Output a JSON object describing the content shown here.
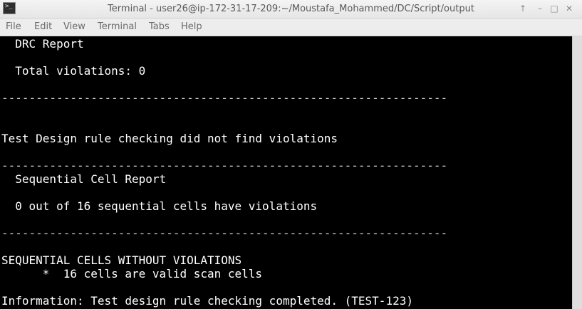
{
  "window": {
    "title": "Terminal - user26@ip-172-31-17-209:~/Moustafa_Mohammed/DC/Script/output",
    "app_icon": "terminal-icon",
    "app_icon_glyph": ">_",
    "buttons": {
      "maximize_glyph": "↑",
      "minimize_glyph": "–",
      "restore_glyph": "□",
      "close_glyph": "✕"
    }
  },
  "menubar": {
    "items": [
      "File",
      "Edit",
      "View",
      "Terminal",
      "Tabs",
      "Help"
    ]
  },
  "terminal": {
    "lines": [
      "  DRC Report",
      "",
      "  Total violations: 0",
      "",
      "-----------------------------------------------------------------",
      "",
      "",
      "Test Design rule checking did not find violations",
      "",
      "-----------------------------------------------------------------",
      "  Sequential Cell Report",
      "",
      "  0 out of 16 sequential cells have violations",
      "",
      "-----------------------------------------------------------------",
      "",
      "SEQUENTIAL CELLS WITHOUT VIOLATIONS",
      "      *  16 cells are valid scan cells",
      "",
      "Information: Test design rule checking completed. (TEST-123)"
    ]
  }
}
